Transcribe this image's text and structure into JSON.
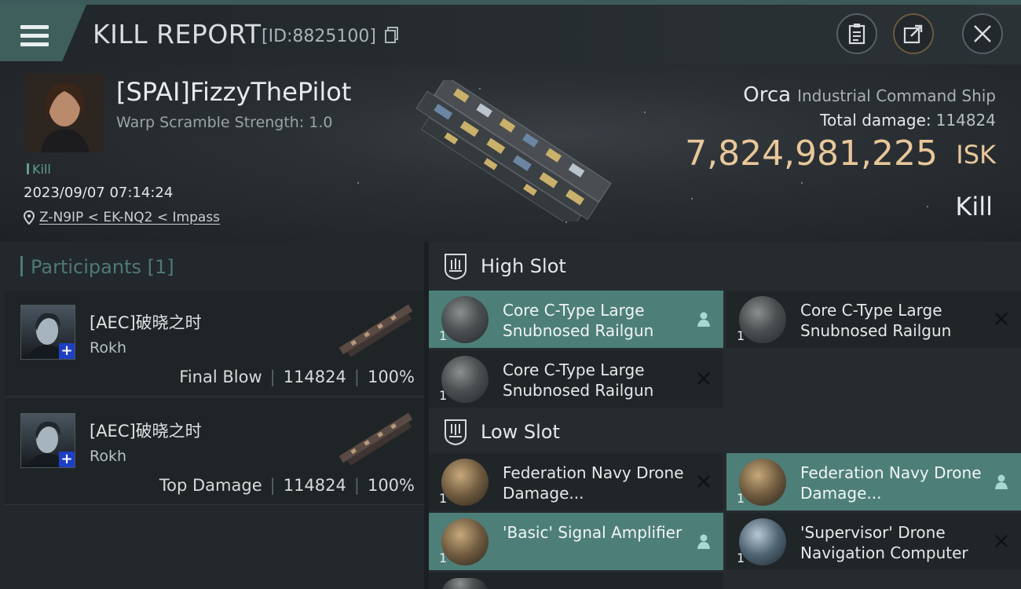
{
  "header": {
    "title": "KILL REPORT",
    "report_id": "[ID:8825100]",
    "menu_icon": "hamburger-menu-icon",
    "buttons": [
      "clipboard-icon",
      "share-icon",
      "close-icon"
    ]
  },
  "victim": {
    "name": "[SPAI]FizzyThePilot",
    "warp_scramble": "Warp Scramble Strength: 1.0",
    "kill_tag": "Kill",
    "datetime": "2023/09/07 07:14:24",
    "location": "Z-N9IP < EK-NQ2 < Impass",
    "ship_name": "Orca",
    "ship_class": "Industrial Command Ship",
    "total_damage_label": "Total damage:",
    "total_damage": "114824",
    "isk_value": "7,824,981,225",
    "isk_unit": "ISK",
    "result": "Kill"
  },
  "participants": {
    "header": "Participants [1]",
    "items": [
      {
        "name": "[AEC]破晓之时",
        "ship": "Rokh",
        "role": "Final Blow",
        "damage": "114824",
        "percent": "100%"
      },
      {
        "name": "[AEC]破晓之时",
        "ship": "Rokh",
        "role": "Top Damage",
        "damage": "114824",
        "percent": "100%"
      }
    ]
  },
  "fitting": {
    "high_slot": {
      "title": "High Slot",
      "modules": [
        {
          "name": "Core C-Type Large Snubnosed Railgun",
          "qty": "1",
          "status": "person-icon"
        },
        {
          "name": "Core C-Type Large Snubnosed Railgun",
          "qty": "1",
          "status": "x-icon"
        },
        {
          "name": "Core C-Type Large Snubnosed Railgun",
          "qty": "1",
          "status": "x-icon"
        }
      ]
    },
    "low_slot": {
      "title": "Low Slot",
      "modules": [
        {
          "name": "Federation Navy Drone Damage...",
          "qty": "1",
          "status": "x-icon"
        },
        {
          "name": "Federation Navy Drone Damage...",
          "qty": "1",
          "status": "person-icon"
        },
        {
          "name": "'Basic' Signal Amplifier",
          "qty": "1",
          "status": "person-icon"
        },
        {
          "name": "'Supervisor' Drone Navigation Computer",
          "qty": "1",
          "status": "x-icon"
        }
      ]
    }
  },
  "colors": {
    "accent_teal": "#4d7f78",
    "isk_gold": "#e8c79a",
    "participants_header": "#4e7a76",
    "plus_badge": "#1d3fc4"
  }
}
